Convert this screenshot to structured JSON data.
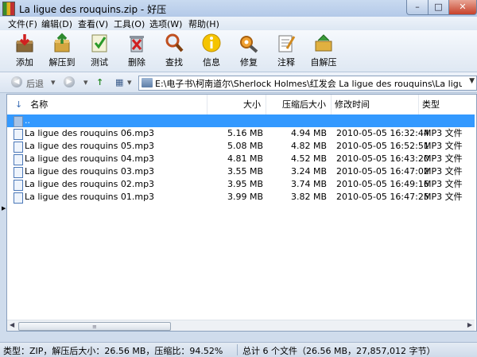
{
  "window": {
    "title": "La ligue des rouquins.zip - 好压",
    "min": "–",
    "max": "□",
    "close": "✕"
  },
  "menu": [
    "文件(F)",
    "编辑(D)",
    "查看(V)",
    "工具(O)",
    "选项(W)",
    "帮助(H)"
  ],
  "toolbar": [
    {
      "label": "添加",
      "icon": "add-icon"
    },
    {
      "label": "解压到",
      "icon": "extract-to-icon"
    },
    {
      "label": "测试",
      "icon": "test-icon"
    },
    {
      "label": "删除",
      "icon": "delete-icon"
    },
    {
      "label": "查找",
      "icon": "find-icon"
    },
    {
      "label": "信息",
      "icon": "info-icon"
    },
    {
      "label": "修复",
      "icon": "repair-icon"
    },
    {
      "label": "注释",
      "icon": "comment-icon"
    },
    {
      "label": "自解压",
      "icon": "self-extract-icon"
    }
  ],
  "nav": {
    "back_label": "后退",
    "path": "E:\\电子书\\柯南道尔\\Sherlock Holmes\\红发会 La ligue des rouquins\\La ligue des rouqui"
  },
  "columns": {
    "name": "名称",
    "size": "大小",
    "packed": "压缩后大小",
    "mtime": "修改时间",
    "type": "类型"
  },
  "parent_row": "..",
  "files": [
    {
      "name": "La ligue des rouquins 06.mp3",
      "size": "5.16 MB",
      "packed": "4.94 MB",
      "mtime": "2010-05-05 16:32:44",
      "type": "MP3 文件"
    },
    {
      "name": "La ligue des rouquins 05.mp3",
      "size": "5.08 MB",
      "packed": "4.82 MB",
      "mtime": "2010-05-05 16:52:51",
      "type": "MP3 文件"
    },
    {
      "name": "La ligue des rouquins 04.mp3",
      "size": "4.81 MB",
      "packed": "4.52 MB",
      "mtime": "2010-05-05 16:43:20",
      "type": "MP3 文件"
    },
    {
      "name": "La ligue des rouquins 03.mp3",
      "size": "3.55 MB",
      "packed": "3.24 MB",
      "mtime": "2010-05-05 16:47:02",
      "type": "MP3 文件"
    },
    {
      "name": "La ligue des rouquins 02.mp3",
      "size": "3.95 MB",
      "packed": "3.74 MB",
      "mtime": "2010-05-05 16:49:16",
      "type": "MP3 文件"
    },
    {
      "name": "La ligue des rouquins 01.mp3",
      "size": "3.99 MB",
      "packed": "3.82 MB",
      "mtime": "2010-05-05 16:47:25",
      "type": "MP3 文件"
    }
  ],
  "status": {
    "left": "类型：ZIP，解压后大小：26.56 MB，压缩比：94.52%",
    "right": "总计 6 个文件（26.56 MB，27,857,012 字节）"
  },
  "colors": {
    "selection": "#3399ff",
    "chrome": "#cfdcec"
  }
}
